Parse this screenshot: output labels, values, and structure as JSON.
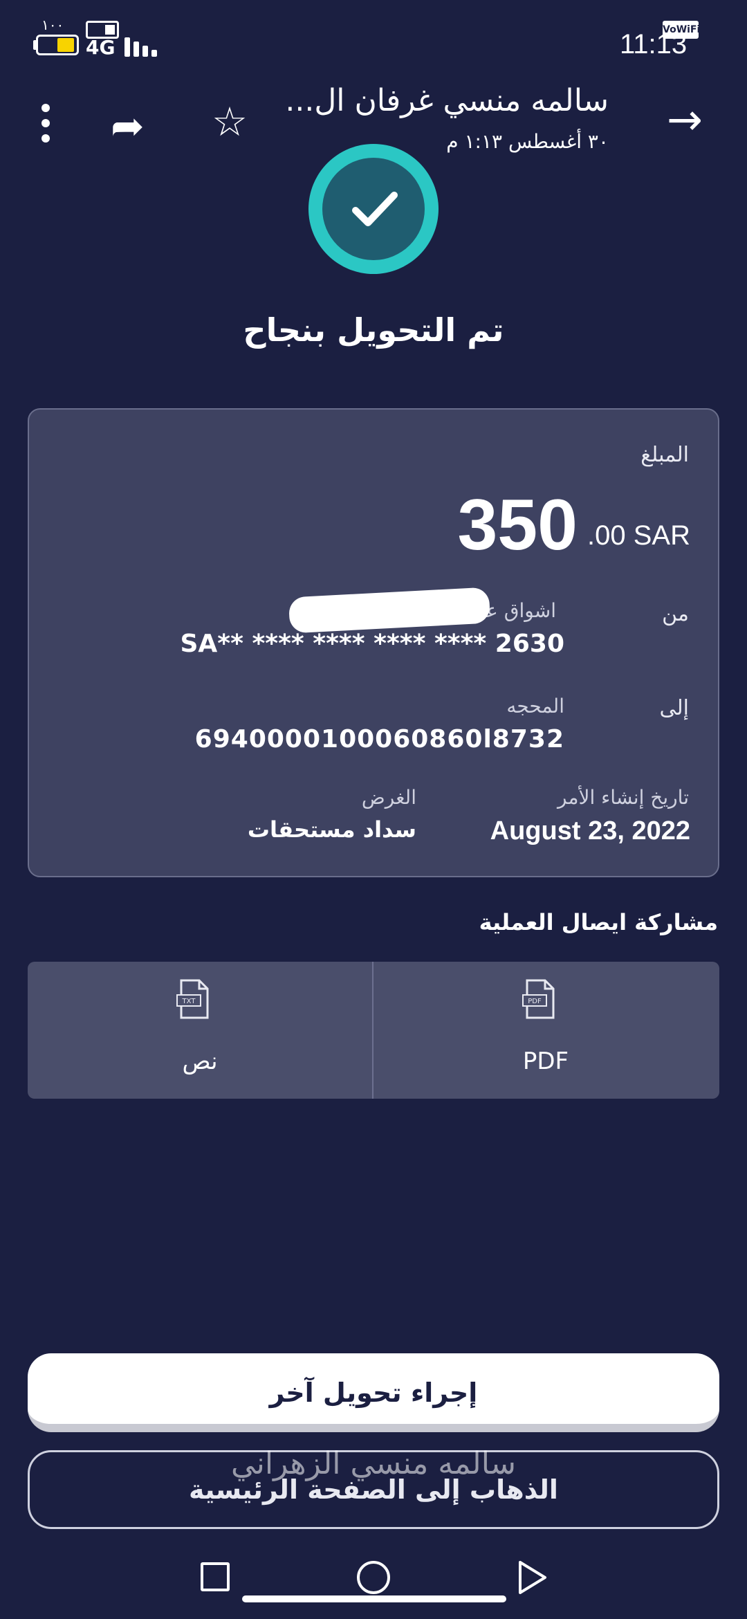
{
  "status_bar": {
    "battery_percent": "١٠٠",
    "network": "4G",
    "time": "11:13",
    "wifi_calling": "VoWiFi"
  },
  "background_header": {
    "name": "سالمه منسي غرفان ال...",
    "date": "٣٠ أغسطس ١:١٣ م"
  },
  "success": {
    "title": "تم التحويل بنجاح"
  },
  "details": {
    "amount_label": "المبلغ",
    "amount_whole": "350",
    "amount_rest": ".00 SAR",
    "from_label": "من",
    "from_name": "اشواق عـ",
    "from_account": "SA** **** **** **** **** 2630",
    "to_label": "إلى",
    "to_name": "المحجه",
    "to_account": "6940000100060860l8732",
    "order_date_label": "تاريخ إنشاء الأمر",
    "order_date": "August 23, 2022",
    "purpose_label": "الغرض",
    "purpose": "سداد مستحقات"
  },
  "share": {
    "title": "مشاركة ايصال العملية",
    "pdf_label": "PDF",
    "pdf_icon_text": "PDF",
    "text_label": "نص",
    "text_icon_text": "TXT"
  },
  "actions": {
    "new_transfer": "إجراء تحويل آخر",
    "go_home": "الذهاب إلى الصفحة الرئيسية"
  },
  "overlay": {
    "name": "سالمه منسي الزهراني"
  },
  "colors": {
    "background": "#1b1f41",
    "card": "#3e4261",
    "accent": "#2bc7c4",
    "battery": "#f8d300"
  }
}
